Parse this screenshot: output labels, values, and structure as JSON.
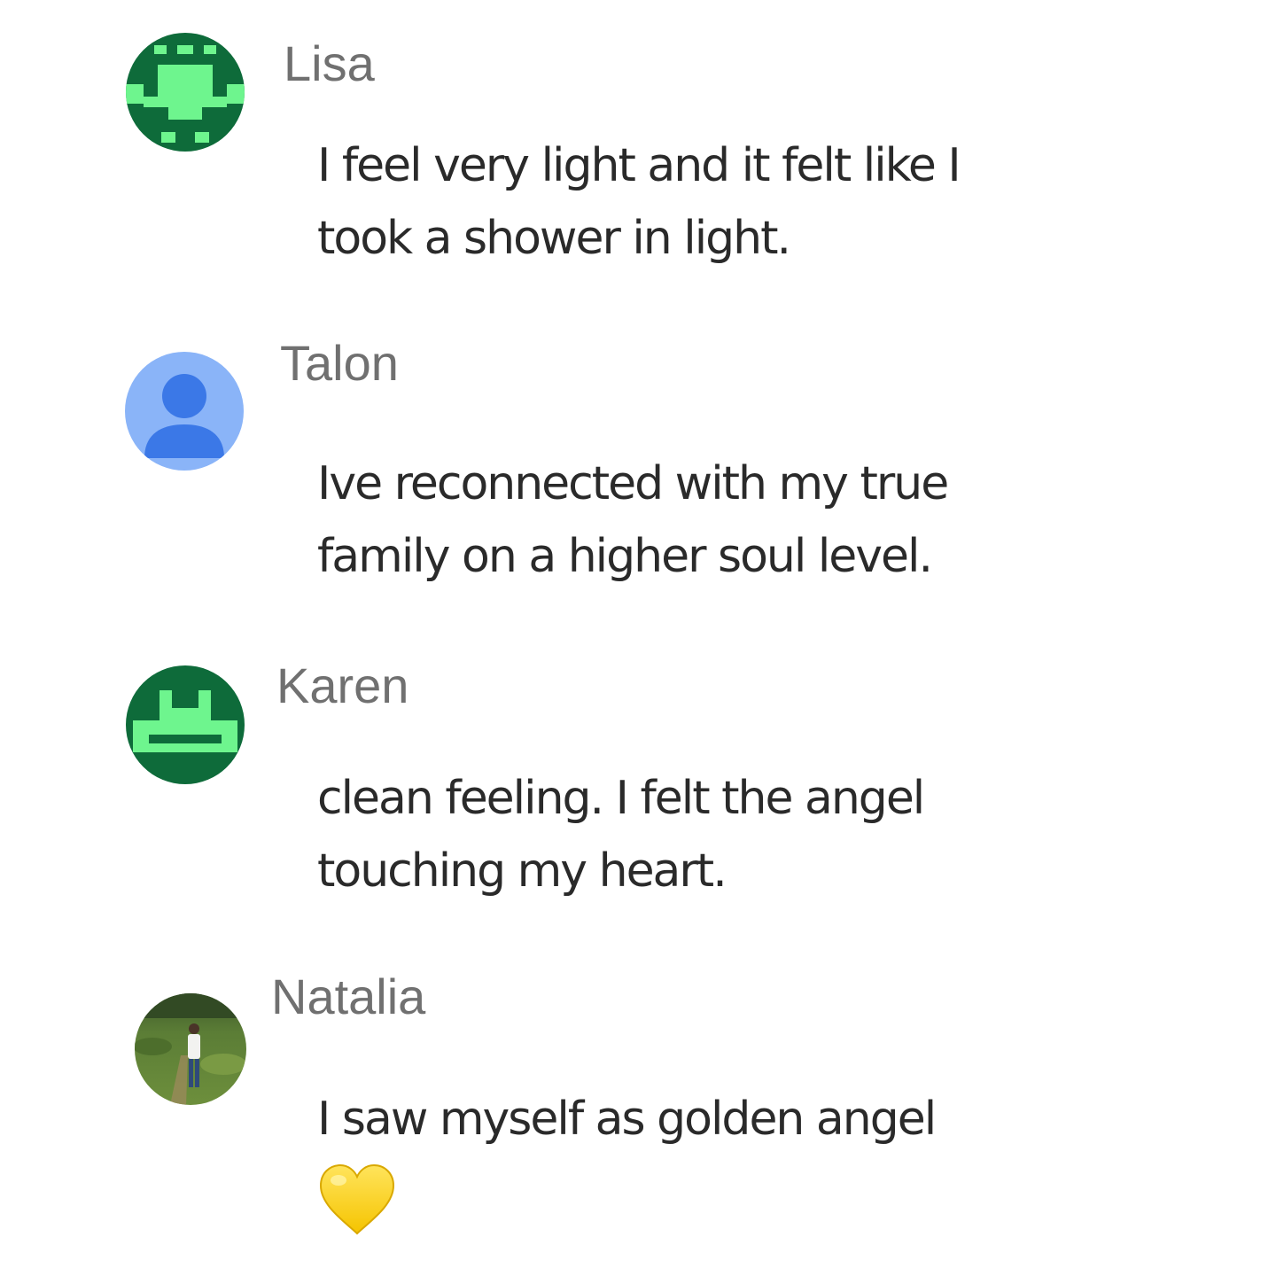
{
  "comments": [
    {
      "author": "Lisa",
      "avatar_icon": "pixel-avatar-icon",
      "avatar_colors": {
        "bg": "#0e6b3a",
        "fg": "#6ef58e"
      },
      "lines": [
        "I feel very light and it felt like I",
        "took a shower in light."
      ]
    },
    {
      "author": "Talon",
      "avatar_icon": "default-person-icon",
      "avatar_colors": {
        "bg": "#8ab4f8",
        "fg": "#3b78e7"
      },
      "lines": [
        "Ive reconnected with my true",
        "family on a higher soul level."
      ]
    },
    {
      "author": "Karen",
      "avatar_icon": "pixel-avatar-icon",
      "avatar_colors": {
        "bg": "#0e6b3a",
        "fg": "#6ef58e"
      },
      "lines": [
        "clean feeling. I felt the angel",
        "touching my heart."
      ]
    },
    {
      "author": "Natalia",
      "avatar_icon": "photo-avatar",
      "lines": [
        "I saw myself as golden angel"
      ],
      "emoji": "yellow-heart-icon"
    }
  ]
}
